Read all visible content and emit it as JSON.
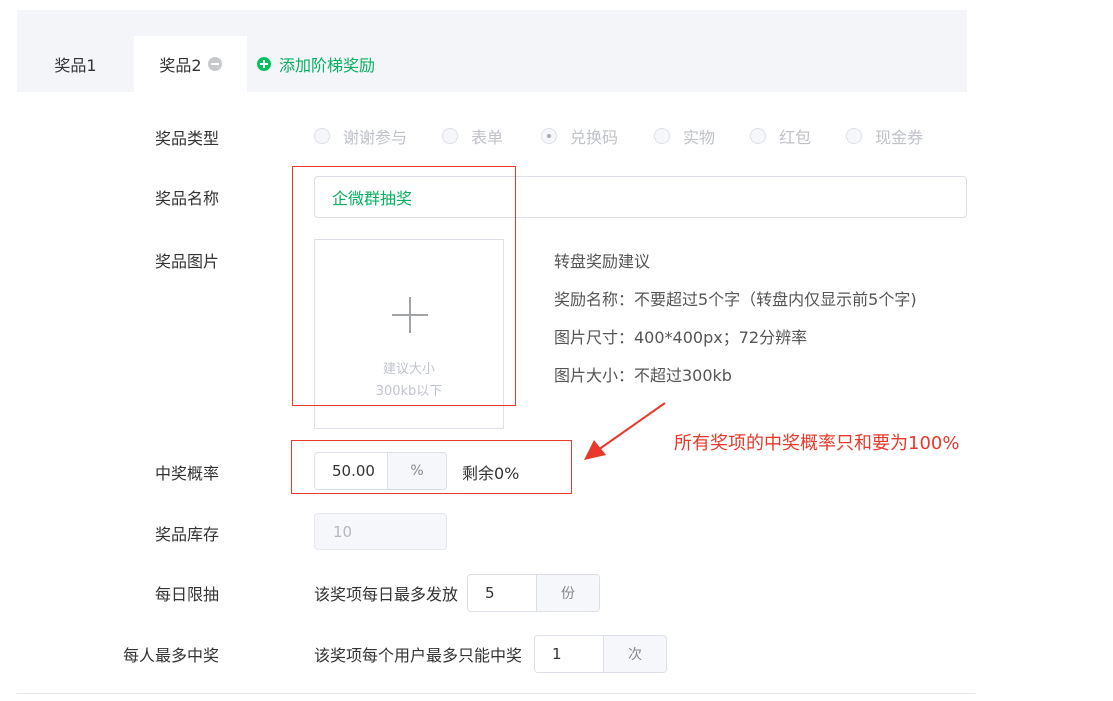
{
  "tabs": {
    "tab1": "奖品1",
    "tab2": "奖品2",
    "add_tier": "添加阶梯奖励"
  },
  "form": {
    "type_label": "奖品类型",
    "type_options": [
      "谢谢参与",
      "表单",
      "兑换码",
      "实物",
      "红包",
      "现金券"
    ],
    "type_selected": "兑换码",
    "name_label": "奖品名称",
    "name_value": "企微群抽奖",
    "image_label": "奖品图片",
    "upload_hint_line1": "建议大小",
    "upload_hint_line2": "300kb以下",
    "tips_title": "转盘奖励建议",
    "tips_name": "奖励名称：不要超过5个字（转盘内仅显示前5个字)",
    "tips_size": "图片尺寸：400*400px；72分辨率",
    "tips_filesize": "图片大小：不超过300kb",
    "prob_label": "中奖概率",
    "prob_value": "50.00",
    "prob_unit": "%",
    "prob_remaining": "剩余0%",
    "stock_label": "奖品库存",
    "stock_value": "10",
    "daily_label": "每日限抽",
    "daily_prefix": "该奖项每日最多发放",
    "daily_value": "5",
    "daily_unit": "份",
    "peruser_label": "每人最多中奖",
    "peruser_prefix": "该奖项每个用户最多只能中奖",
    "peruser_value": "1",
    "peruser_unit": "次"
  },
  "annotation": {
    "text": "所有奖项的中奖概率只和要为100%",
    "color": "#e8392a"
  },
  "colors": {
    "accent_green": "#07c160",
    "annotation_red": "#e8392a"
  }
}
